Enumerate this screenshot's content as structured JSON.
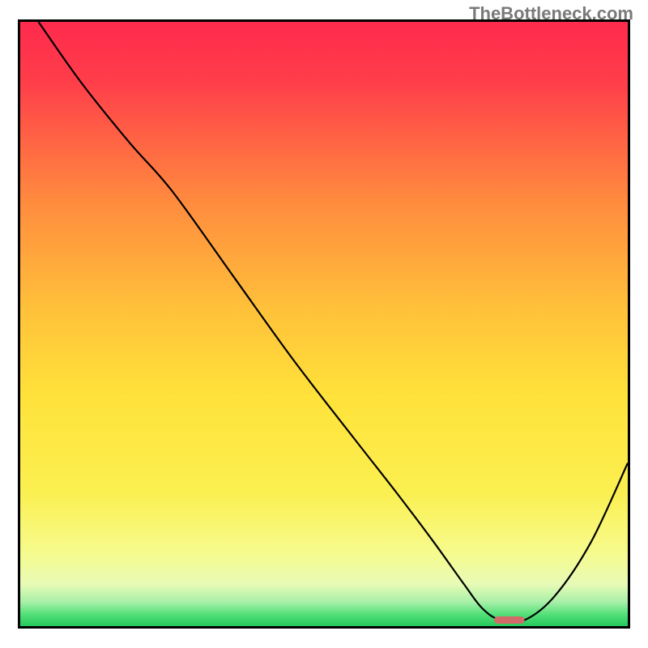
{
  "watermark": "TheBottleneck.com",
  "chart_data": {
    "type": "line",
    "title": "",
    "xlabel": "",
    "ylabel": "",
    "xlim": [
      0,
      100
    ],
    "ylim": [
      0,
      100
    ],
    "background_gradient": {
      "top": "#FF2A4D",
      "mid_upper": "#FFB43B",
      "mid": "#FFE63C",
      "mid_lower": "#F6FB8E",
      "green": "#3EE06C",
      "bottom": "#24C95C"
    },
    "series": [
      {
        "name": "bottleneck-curve",
        "x": [
          3.0,
          10.0,
          18.0,
          25.0,
          35.0,
          45.0,
          55.0,
          62.0,
          68.0,
          73.0,
          76.0,
          79.0,
          83.0,
          88.0,
          94.0,
          100.0
        ],
        "y": [
          100.0,
          90.0,
          80.0,
          72.0,
          58.0,
          44.0,
          31.0,
          22.0,
          14.0,
          7.0,
          3.0,
          1.0,
          1.0,
          5.0,
          14.0,
          27.0
        ]
      }
    ],
    "marker": {
      "name": "optimal-indicator",
      "x": 80.5,
      "y": 1.0,
      "width": 5.0,
      "height": 1.2,
      "color": "#d36a6a"
    }
  }
}
